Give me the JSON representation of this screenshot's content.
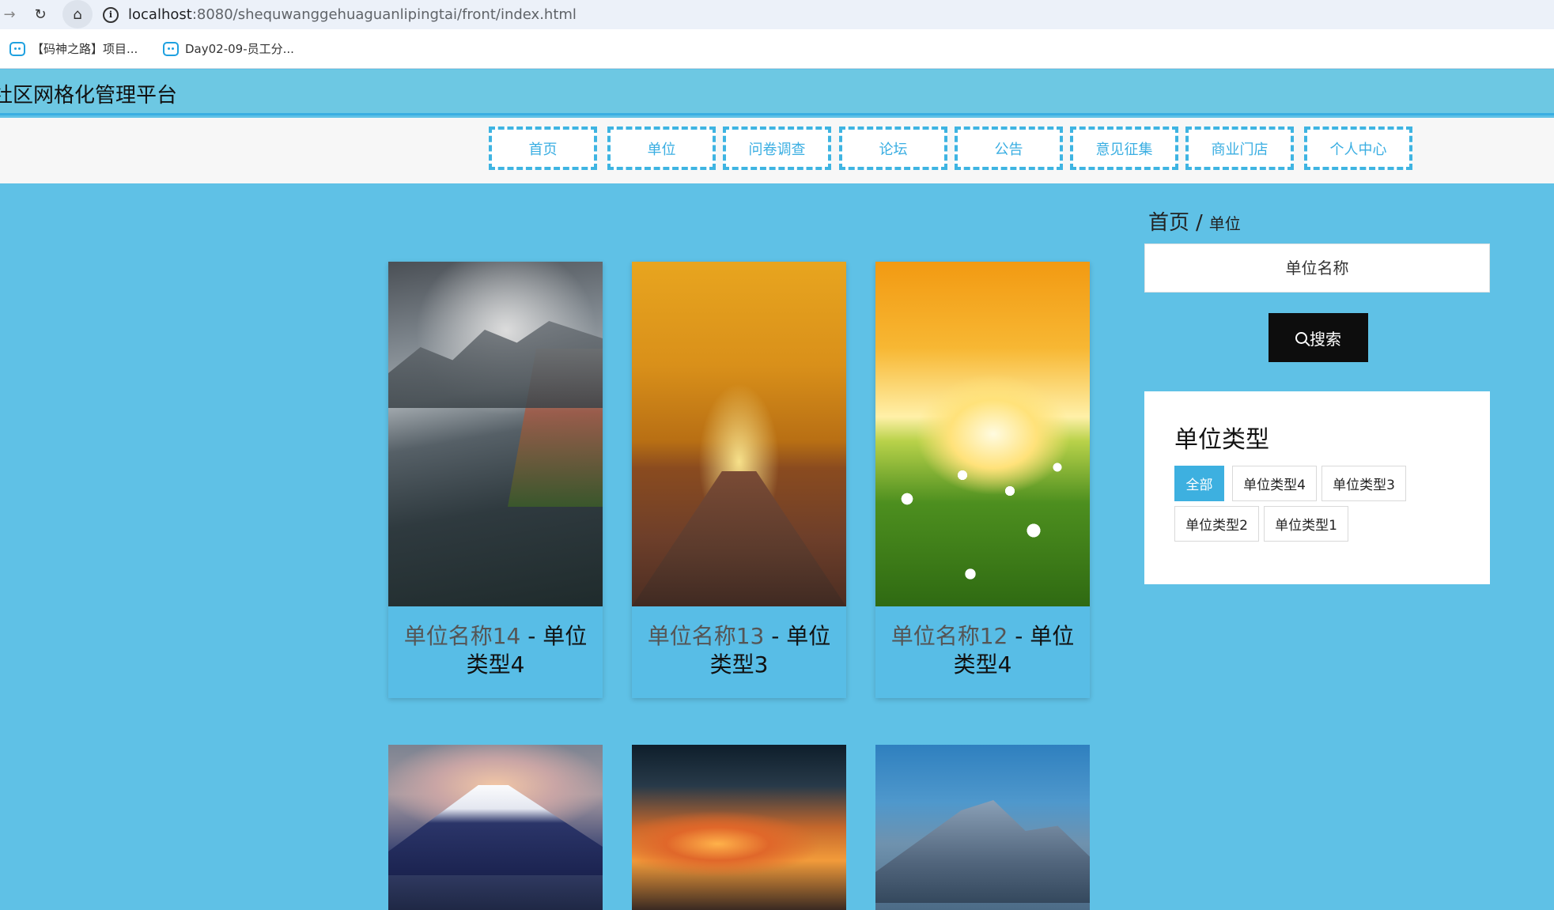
{
  "browser": {
    "url_host": "localhost",
    "url_rest": ":8080/shequwanggehuaguanlipingtai/front/index.html",
    "bookmarks": [
      {
        "label": "【码神之路】项目..."
      },
      {
        "label": "Day02-09-员工分..."
      }
    ]
  },
  "site": {
    "title": "社区网格化管理平台"
  },
  "nav": {
    "items": [
      {
        "label": "首页"
      },
      {
        "label": "单位"
      },
      {
        "label": "问卷调查"
      },
      {
        "label": "论坛"
      },
      {
        "label": "公告"
      },
      {
        "label": "意见征集"
      },
      {
        "label": "商业门店"
      },
      {
        "label": "个人中心"
      }
    ]
  },
  "breadcrumb": {
    "home": "首页",
    "separator": "/",
    "current": "单位"
  },
  "search": {
    "placeholder": "单位名称",
    "button_label": "搜索"
  },
  "type_panel": {
    "title": "单位类型",
    "tags": [
      {
        "label": "全部",
        "active": true
      },
      {
        "label": "单位类型4"
      },
      {
        "label": "单位类型3"
      },
      {
        "label": "单位类型2"
      },
      {
        "label": "单位类型1"
      }
    ]
  },
  "cards": [
    {
      "name": "单位名称14",
      "sep": " - ",
      "type": "单位类型4"
    },
    {
      "name": "单位名称13",
      "sep": " - ",
      "type": "单位类型3"
    },
    {
      "name": "单位名称12",
      "sep": " - ",
      "type": "单位类型4"
    }
  ],
  "colors": {
    "page_bg": "#5fc1e6",
    "accent": "#3db0e0",
    "nav_border": "#3eb4e2"
  }
}
